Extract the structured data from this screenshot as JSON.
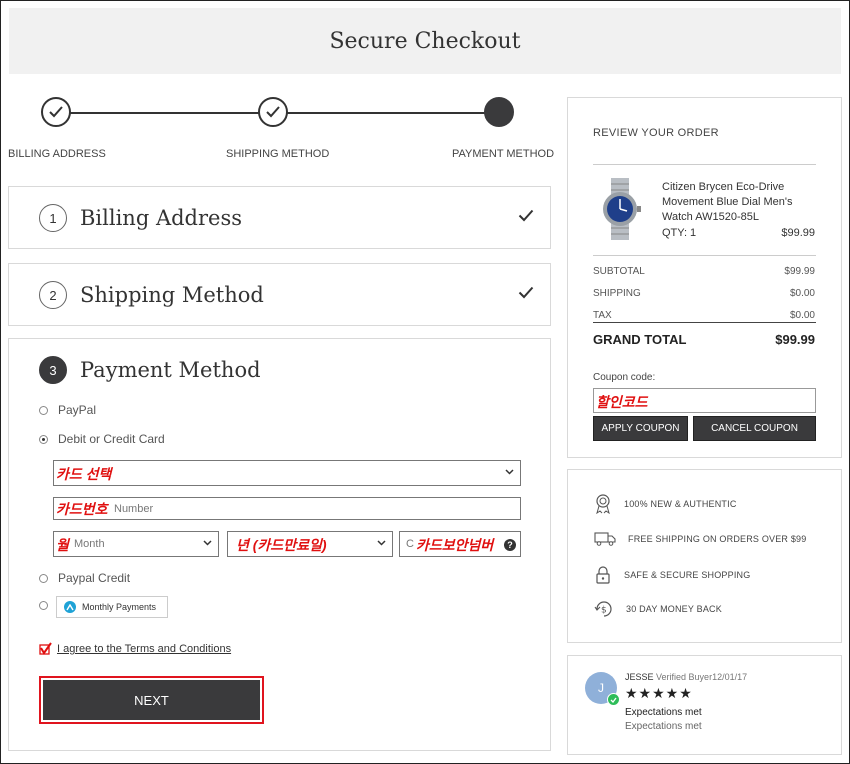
{
  "header": {
    "title": "Secure Checkout"
  },
  "progress": {
    "steps": [
      {
        "label": "BILLING ADDRESS",
        "state": "done"
      },
      {
        "label": "SHIPPING METHOD",
        "state": "done"
      },
      {
        "label": "PAYMENT METHOD",
        "state": "active"
      }
    ]
  },
  "sections": {
    "billing": {
      "number": "1",
      "title": "Billing Address"
    },
    "shipping": {
      "number": "2",
      "title": "Shipping Method"
    },
    "payment": {
      "number": "3",
      "title": "Payment Method"
    }
  },
  "payment": {
    "options": {
      "paypal": "PayPal",
      "card": "Debit or Credit Card",
      "paypal_credit": "Paypal Credit",
      "monthly": "Monthly Payments"
    },
    "selected": "card",
    "card_type_annotation": "카드 선택",
    "card_number_placeholder": "Number",
    "card_number_annotation": "카드번호",
    "month_placeholder": "Month",
    "month_annotation": "월",
    "year_annotation": "년 (카드만료일)",
    "cvv_placeholder": "C",
    "cvv_annotation": "카드보안넘버",
    "cvv_help": "?",
    "agree_text": "I agree to the Terms and Conditions",
    "next_label": "NEXT"
  },
  "review": {
    "title": "REVIEW YOUR ORDER",
    "product_name": "Citizen Brycen Eco-Drive Movement Blue Dial Men's Watch AW1520-85L",
    "qty_label": "QTY:",
    "qty": "1",
    "price": "$99.99",
    "subtotal_label": "SUBTOTAL",
    "subtotal": "$99.99",
    "shipping_label": "SHIPPING",
    "shipping": "$0.00",
    "tax_label": "TAX",
    "tax": "$0.00",
    "grand_total_label": "GRAND TOTAL",
    "grand_total": "$99.99",
    "coupon_label": "Coupon code:",
    "coupon_annotation": "할인코드",
    "apply_label": "APPLY COUPON",
    "cancel_label": "CANCEL COUPON"
  },
  "badges": [
    {
      "icon": "award-ribbon-icon",
      "text": "100% NEW & AUTHENTIC"
    },
    {
      "icon": "truck-icon",
      "text": "FREE SHIPPING ON ORDERS OVER $99"
    },
    {
      "icon": "lock-icon",
      "text": "SAFE & SECURE SHOPPING"
    },
    {
      "icon": "money-back-icon",
      "text": "30 DAY MONEY BACK"
    }
  ],
  "testimonial": {
    "initial": "J",
    "name": "JESSE",
    "verified": "Verified Buyer",
    "date": "12/01/17",
    "stars": "★★★★★",
    "headline": "Expectations met",
    "body": "Expectations met"
  },
  "colors": {
    "dark": "#3a3a3c",
    "annotation_red": "#e01010",
    "highlight_border": "#e0141e"
  }
}
